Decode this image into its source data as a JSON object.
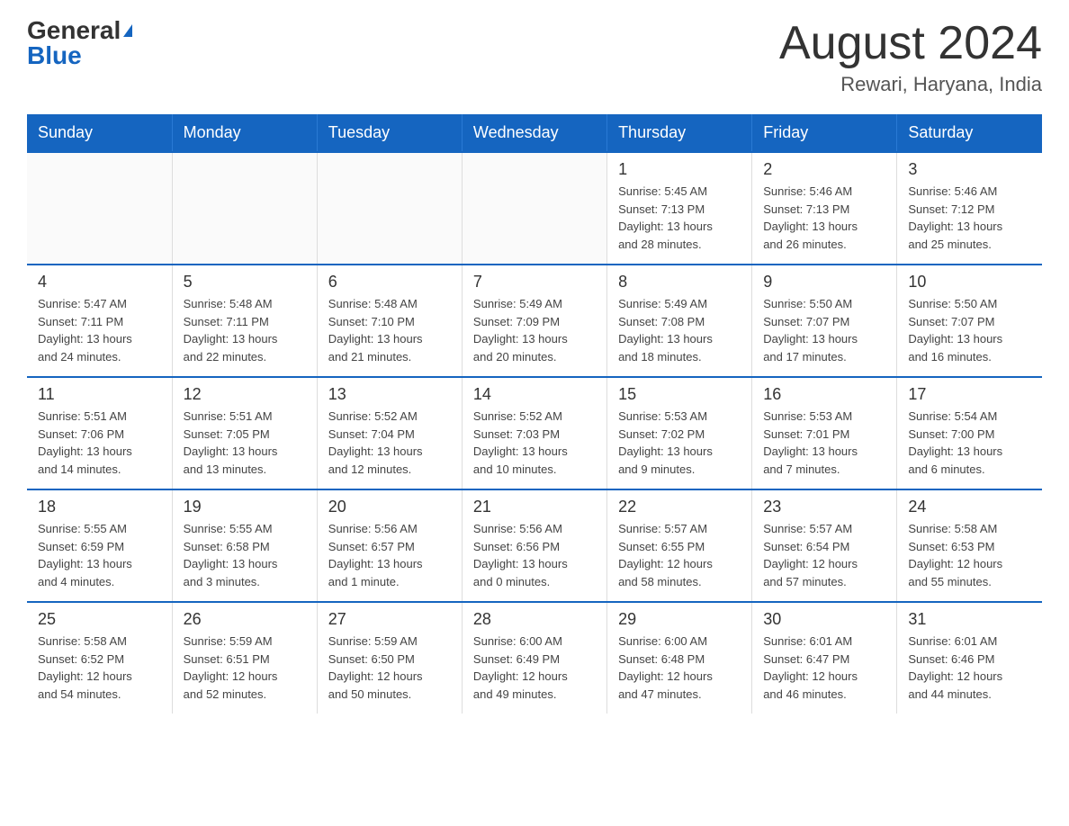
{
  "logo": {
    "general": "General",
    "blue": "Blue"
  },
  "title": "August 2024",
  "location": "Rewari, Haryana, India",
  "weekdays": [
    "Sunday",
    "Monday",
    "Tuesday",
    "Wednesday",
    "Thursday",
    "Friday",
    "Saturday"
  ],
  "weeks": [
    [
      {
        "day": "",
        "info": ""
      },
      {
        "day": "",
        "info": ""
      },
      {
        "day": "",
        "info": ""
      },
      {
        "day": "",
        "info": ""
      },
      {
        "day": "1",
        "info": "Sunrise: 5:45 AM\nSunset: 7:13 PM\nDaylight: 13 hours\nand 28 minutes."
      },
      {
        "day": "2",
        "info": "Sunrise: 5:46 AM\nSunset: 7:13 PM\nDaylight: 13 hours\nand 26 minutes."
      },
      {
        "day": "3",
        "info": "Sunrise: 5:46 AM\nSunset: 7:12 PM\nDaylight: 13 hours\nand 25 minutes."
      }
    ],
    [
      {
        "day": "4",
        "info": "Sunrise: 5:47 AM\nSunset: 7:11 PM\nDaylight: 13 hours\nand 24 minutes."
      },
      {
        "day": "5",
        "info": "Sunrise: 5:48 AM\nSunset: 7:11 PM\nDaylight: 13 hours\nand 22 minutes."
      },
      {
        "day": "6",
        "info": "Sunrise: 5:48 AM\nSunset: 7:10 PM\nDaylight: 13 hours\nand 21 minutes."
      },
      {
        "day": "7",
        "info": "Sunrise: 5:49 AM\nSunset: 7:09 PM\nDaylight: 13 hours\nand 20 minutes."
      },
      {
        "day": "8",
        "info": "Sunrise: 5:49 AM\nSunset: 7:08 PM\nDaylight: 13 hours\nand 18 minutes."
      },
      {
        "day": "9",
        "info": "Sunrise: 5:50 AM\nSunset: 7:07 PM\nDaylight: 13 hours\nand 17 minutes."
      },
      {
        "day": "10",
        "info": "Sunrise: 5:50 AM\nSunset: 7:07 PM\nDaylight: 13 hours\nand 16 minutes."
      }
    ],
    [
      {
        "day": "11",
        "info": "Sunrise: 5:51 AM\nSunset: 7:06 PM\nDaylight: 13 hours\nand 14 minutes."
      },
      {
        "day": "12",
        "info": "Sunrise: 5:51 AM\nSunset: 7:05 PM\nDaylight: 13 hours\nand 13 minutes."
      },
      {
        "day": "13",
        "info": "Sunrise: 5:52 AM\nSunset: 7:04 PM\nDaylight: 13 hours\nand 12 minutes."
      },
      {
        "day": "14",
        "info": "Sunrise: 5:52 AM\nSunset: 7:03 PM\nDaylight: 13 hours\nand 10 minutes."
      },
      {
        "day": "15",
        "info": "Sunrise: 5:53 AM\nSunset: 7:02 PM\nDaylight: 13 hours\nand 9 minutes."
      },
      {
        "day": "16",
        "info": "Sunrise: 5:53 AM\nSunset: 7:01 PM\nDaylight: 13 hours\nand 7 minutes."
      },
      {
        "day": "17",
        "info": "Sunrise: 5:54 AM\nSunset: 7:00 PM\nDaylight: 13 hours\nand 6 minutes."
      }
    ],
    [
      {
        "day": "18",
        "info": "Sunrise: 5:55 AM\nSunset: 6:59 PM\nDaylight: 13 hours\nand 4 minutes."
      },
      {
        "day": "19",
        "info": "Sunrise: 5:55 AM\nSunset: 6:58 PM\nDaylight: 13 hours\nand 3 minutes."
      },
      {
        "day": "20",
        "info": "Sunrise: 5:56 AM\nSunset: 6:57 PM\nDaylight: 13 hours\nand 1 minute."
      },
      {
        "day": "21",
        "info": "Sunrise: 5:56 AM\nSunset: 6:56 PM\nDaylight: 13 hours\nand 0 minutes."
      },
      {
        "day": "22",
        "info": "Sunrise: 5:57 AM\nSunset: 6:55 PM\nDaylight: 12 hours\nand 58 minutes."
      },
      {
        "day": "23",
        "info": "Sunrise: 5:57 AM\nSunset: 6:54 PM\nDaylight: 12 hours\nand 57 minutes."
      },
      {
        "day": "24",
        "info": "Sunrise: 5:58 AM\nSunset: 6:53 PM\nDaylight: 12 hours\nand 55 minutes."
      }
    ],
    [
      {
        "day": "25",
        "info": "Sunrise: 5:58 AM\nSunset: 6:52 PM\nDaylight: 12 hours\nand 54 minutes."
      },
      {
        "day": "26",
        "info": "Sunrise: 5:59 AM\nSunset: 6:51 PM\nDaylight: 12 hours\nand 52 minutes."
      },
      {
        "day": "27",
        "info": "Sunrise: 5:59 AM\nSunset: 6:50 PM\nDaylight: 12 hours\nand 50 minutes."
      },
      {
        "day": "28",
        "info": "Sunrise: 6:00 AM\nSunset: 6:49 PM\nDaylight: 12 hours\nand 49 minutes."
      },
      {
        "day": "29",
        "info": "Sunrise: 6:00 AM\nSunset: 6:48 PM\nDaylight: 12 hours\nand 47 minutes."
      },
      {
        "day": "30",
        "info": "Sunrise: 6:01 AM\nSunset: 6:47 PM\nDaylight: 12 hours\nand 46 minutes."
      },
      {
        "day": "31",
        "info": "Sunrise: 6:01 AM\nSunset: 6:46 PM\nDaylight: 12 hours\nand 44 minutes."
      }
    ]
  ]
}
